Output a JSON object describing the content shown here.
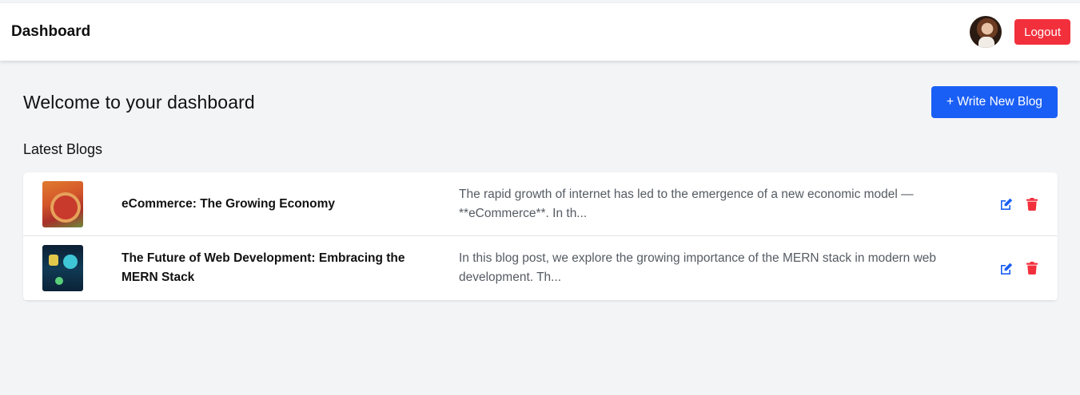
{
  "header": {
    "brand": "Dashboard",
    "logout_label": "Logout",
    "avatar_icon": "user-avatar"
  },
  "main": {
    "title": "Welcome to your dashboard",
    "write_button": "+ Write New Blog",
    "section_title": "Latest Blogs"
  },
  "blogs": [
    {
      "title": "eCommerce: The Growing Economy",
      "excerpt": "The rapid growth of internet has led to the emergence of a new economic model — **eCommerce**. In th...",
      "thumbnail_icon": "ecommerce-cover-image"
    },
    {
      "title": "The Future of Web Development: Embracing the MERN Stack",
      "excerpt": "In this blog post, we explore the growing importance of the MERN stack in modern web development. Th...",
      "thumbnail_icon": "web-development-cover-image"
    }
  ],
  "icons": {
    "edit": "edit-icon",
    "delete": "trash-icon"
  },
  "colors": {
    "primary": "#1a5ff5",
    "danger": "#f2303c",
    "edit_icon": "#1a5ff5",
    "delete_icon": "#f2303c",
    "background": "#f3f4f6"
  }
}
